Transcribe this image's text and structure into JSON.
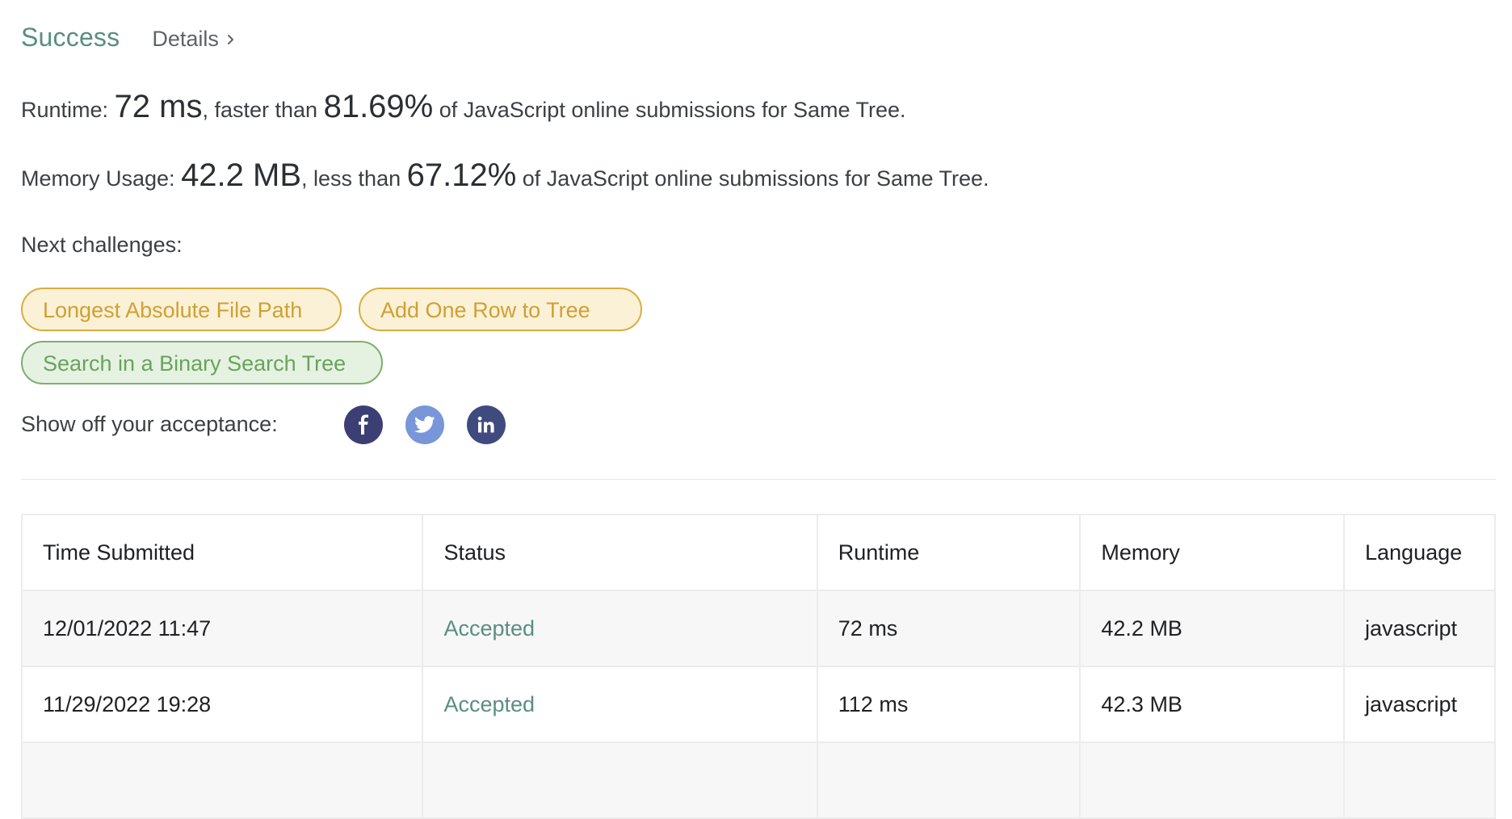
{
  "header": {
    "status": "Success",
    "details_label": "Details"
  },
  "runtime_stat": {
    "prefix": "Runtime: ",
    "value": "72 ms",
    "middle": ", faster than ",
    "percent": "81.69%",
    "suffix": " of JavaScript online submissions for Same Tree."
  },
  "memory_stat": {
    "prefix": "Memory Usage: ",
    "value": "42.2 MB",
    "middle": ", less than ",
    "percent": "67.12%",
    "suffix": " of JavaScript online submissions for Same Tree."
  },
  "next_challenges": {
    "label": "Next challenges:",
    "items": [
      {
        "title": "Longest Absolute File Path",
        "difficulty": "medium"
      },
      {
        "title": "Add One Row to Tree",
        "difficulty": "medium"
      },
      {
        "title": "Search in a Binary Search Tree",
        "difficulty": "easy"
      }
    ]
  },
  "share": {
    "label": "Show off your acceptance:",
    "icons": [
      "facebook-icon",
      "twitter-icon",
      "linkedin-icon"
    ]
  },
  "submissions_table": {
    "headers": [
      "Time Submitted",
      "Status",
      "Runtime",
      "Memory",
      "Language"
    ],
    "rows": [
      [
        "12/01/2022 11:47",
        "Accepted",
        "72 ms",
        "42.2 MB",
        "javascript"
      ],
      [
        "11/29/2022 19:28",
        "Accepted",
        "112 ms",
        "42.3 MB",
        "javascript"
      ]
    ]
  },
  "colors": {
    "success": "#5a8d83",
    "medium": "#d9ae3f",
    "easy": "#7cb06c"
  }
}
